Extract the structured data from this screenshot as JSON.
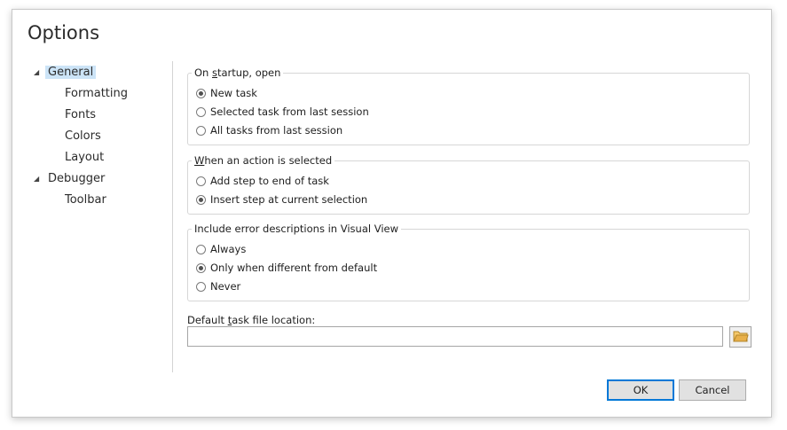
{
  "dialog": {
    "title": "Options"
  },
  "tree": {
    "items": [
      {
        "label": "General",
        "expanded": true,
        "selected": true
      },
      {
        "label": "Formatting"
      },
      {
        "label": "Fonts"
      },
      {
        "label": "Colors"
      },
      {
        "label": "Layout"
      },
      {
        "label": "Debugger",
        "expanded": true
      },
      {
        "label": "Toolbar"
      }
    ]
  },
  "startup_group": {
    "legend_pre": "On ",
    "legend_ul": "s",
    "legend_post": "tartup, open",
    "options": [
      {
        "label": "New task",
        "checked": true
      },
      {
        "label": "Selected task from last session",
        "checked": false
      },
      {
        "label": "All tasks from last session",
        "checked": false
      }
    ]
  },
  "action_group": {
    "legend_ul": "W",
    "legend_post": "hen an action is selected",
    "options": [
      {
        "label": "Add step to end of task",
        "checked": false
      },
      {
        "label": "Insert step at current selection",
        "checked": true
      }
    ]
  },
  "error_group": {
    "legend": "Include error descriptions in Visual View",
    "options": [
      {
        "label": "Always",
        "checked": false
      },
      {
        "label": "Only when different from default",
        "checked": true
      },
      {
        "label": "Never",
        "checked": false
      }
    ]
  },
  "file_location": {
    "label_pre": "Default ",
    "label_ul": "t",
    "label_post": "ask file location:",
    "value": ""
  },
  "buttons": {
    "ok": "OK",
    "cancel": "Cancel"
  },
  "icons": {
    "browse": "folder-icon",
    "expand": "expanded-triangle-icon"
  },
  "colors": {
    "selection": "#cce4f7",
    "folder": "#e8b04a",
    "default_border": "#0078d7"
  }
}
